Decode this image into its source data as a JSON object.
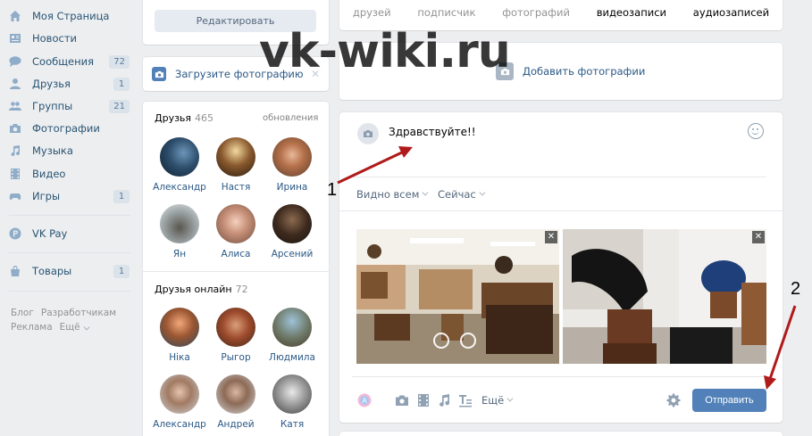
{
  "nav": {
    "items": [
      {
        "label": "Моя Страница",
        "icon": "home-icon",
        "badge": ""
      },
      {
        "label": "Новости",
        "icon": "news-icon",
        "badge": ""
      },
      {
        "label": "Сообщения",
        "icon": "messages-icon",
        "badge": "72"
      },
      {
        "label": "Друзья",
        "icon": "friends-icon",
        "badge": "1"
      },
      {
        "label": "Группы",
        "icon": "groups-icon",
        "badge": "21"
      },
      {
        "label": "Фотографии",
        "icon": "photos-icon",
        "badge": ""
      },
      {
        "label": "Музыка",
        "icon": "music-icon",
        "badge": ""
      },
      {
        "label": "Видео",
        "icon": "video-icon",
        "badge": ""
      },
      {
        "label": "Игры",
        "icon": "games-icon",
        "badge": "1"
      },
      {
        "label": "VK Pay",
        "icon": "vkpay-icon",
        "badge": ""
      },
      {
        "label": "Товары",
        "icon": "goods-icon",
        "badge": "1"
      }
    ],
    "footer": {
      "blog": "Блог",
      "developers": "Разработчикам",
      "ads": "Реклама",
      "more": "Ещё"
    }
  },
  "profile": {
    "edit_label": "Редактировать",
    "upload_label": "Загрузите фотографию"
  },
  "friends": {
    "title": "Друзья",
    "count": "465",
    "updates_link": "обновления",
    "list": [
      "Александр",
      "Настя",
      "Ирина",
      "Ян",
      "Алиса",
      "Арсений"
    ]
  },
  "friends_online": {
    "title": "Друзья онлайн",
    "count": "72",
    "list": [
      "Ніка",
      "Рыгор",
      "Людмила",
      "Александр",
      "Андрей",
      "Катя"
    ]
  },
  "stats": [
    "друзей",
    "подписчик",
    "фотографий",
    "видеозаписи",
    "аудиозаписей"
  ],
  "add_photos_label": "Добавить фотографии",
  "post": {
    "text": "Здравствуйте!!",
    "visibility": "Видно всем",
    "time": "Сейчас",
    "more": "Ещё",
    "send_label": "Отправить"
  },
  "watermark": "vk-wiki.ru",
  "annotations": [
    "1",
    "2"
  ],
  "colors": {
    "accent": "#5181b8",
    "link": "#2a5885",
    "background": "#edeef0"
  }
}
